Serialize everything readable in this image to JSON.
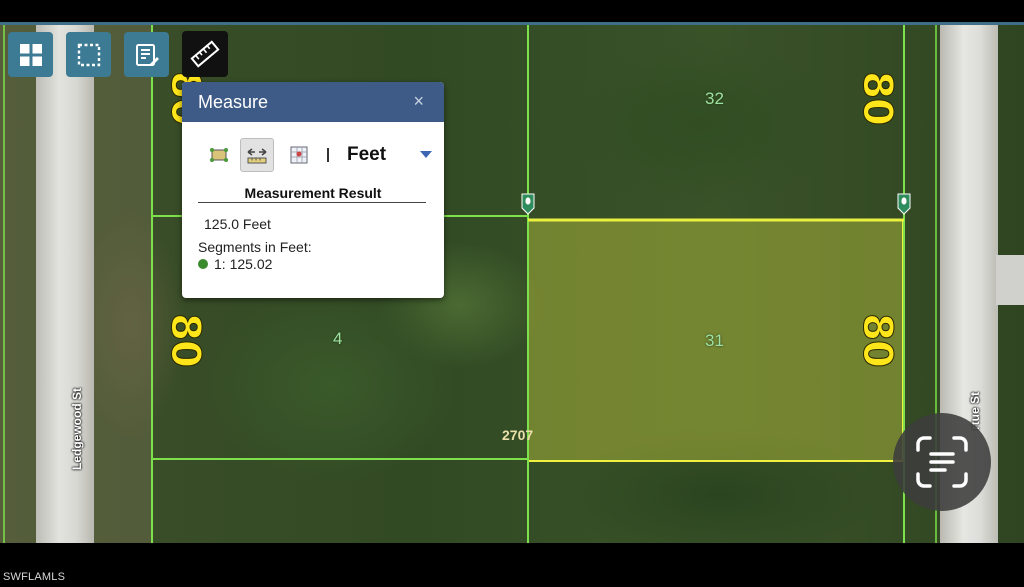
{
  "map": {
    "streets": [
      {
        "name": "Ledgewood St"
      },
      {
        "name": "rtue St"
      }
    ],
    "lots": [
      {
        "number": "32"
      },
      {
        "number": "4"
      },
      {
        "number": "31"
      }
    ],
    "dimensions": {
      "top_left": "80",
      "top_right": "80",
      "mid_left": "80",
      "mid_right": "80"
    },
    "address": "2707",
    "highlight_color": "#e8e830"
  },
  "toolbar": {
    "buttons": [
      {
        "icon": "grid-icon"
      },
      {
        "icon": "select-area-icon"
      },
      {
        "icon": "edit-form-icon"
      },
      {
        "icon": "ruler-icon"
      }
    ]
  },
  "measure_panel": {
    "title": "Measure",
    "close": "×",
    "tools": [
      {
        "icon": "area-tool-icon"
      },
      {
        "icon": "distance-tool-icon",
        "active": true
      },
      {
        "icon": "location-tool-icon"
      }
    ],
    "unit": "Feet",
    "result_heading": "Measurement Result",
    "result_value": "125.0 Feet",
    "segments_label": "Segments in Feet:",
    "segments": [
      "1: 125.02"
    ]
  },
  "scan_button": {
    "icon": "scan-text-icon"
  },
  "watermark": "SWFLAMLS"
}
